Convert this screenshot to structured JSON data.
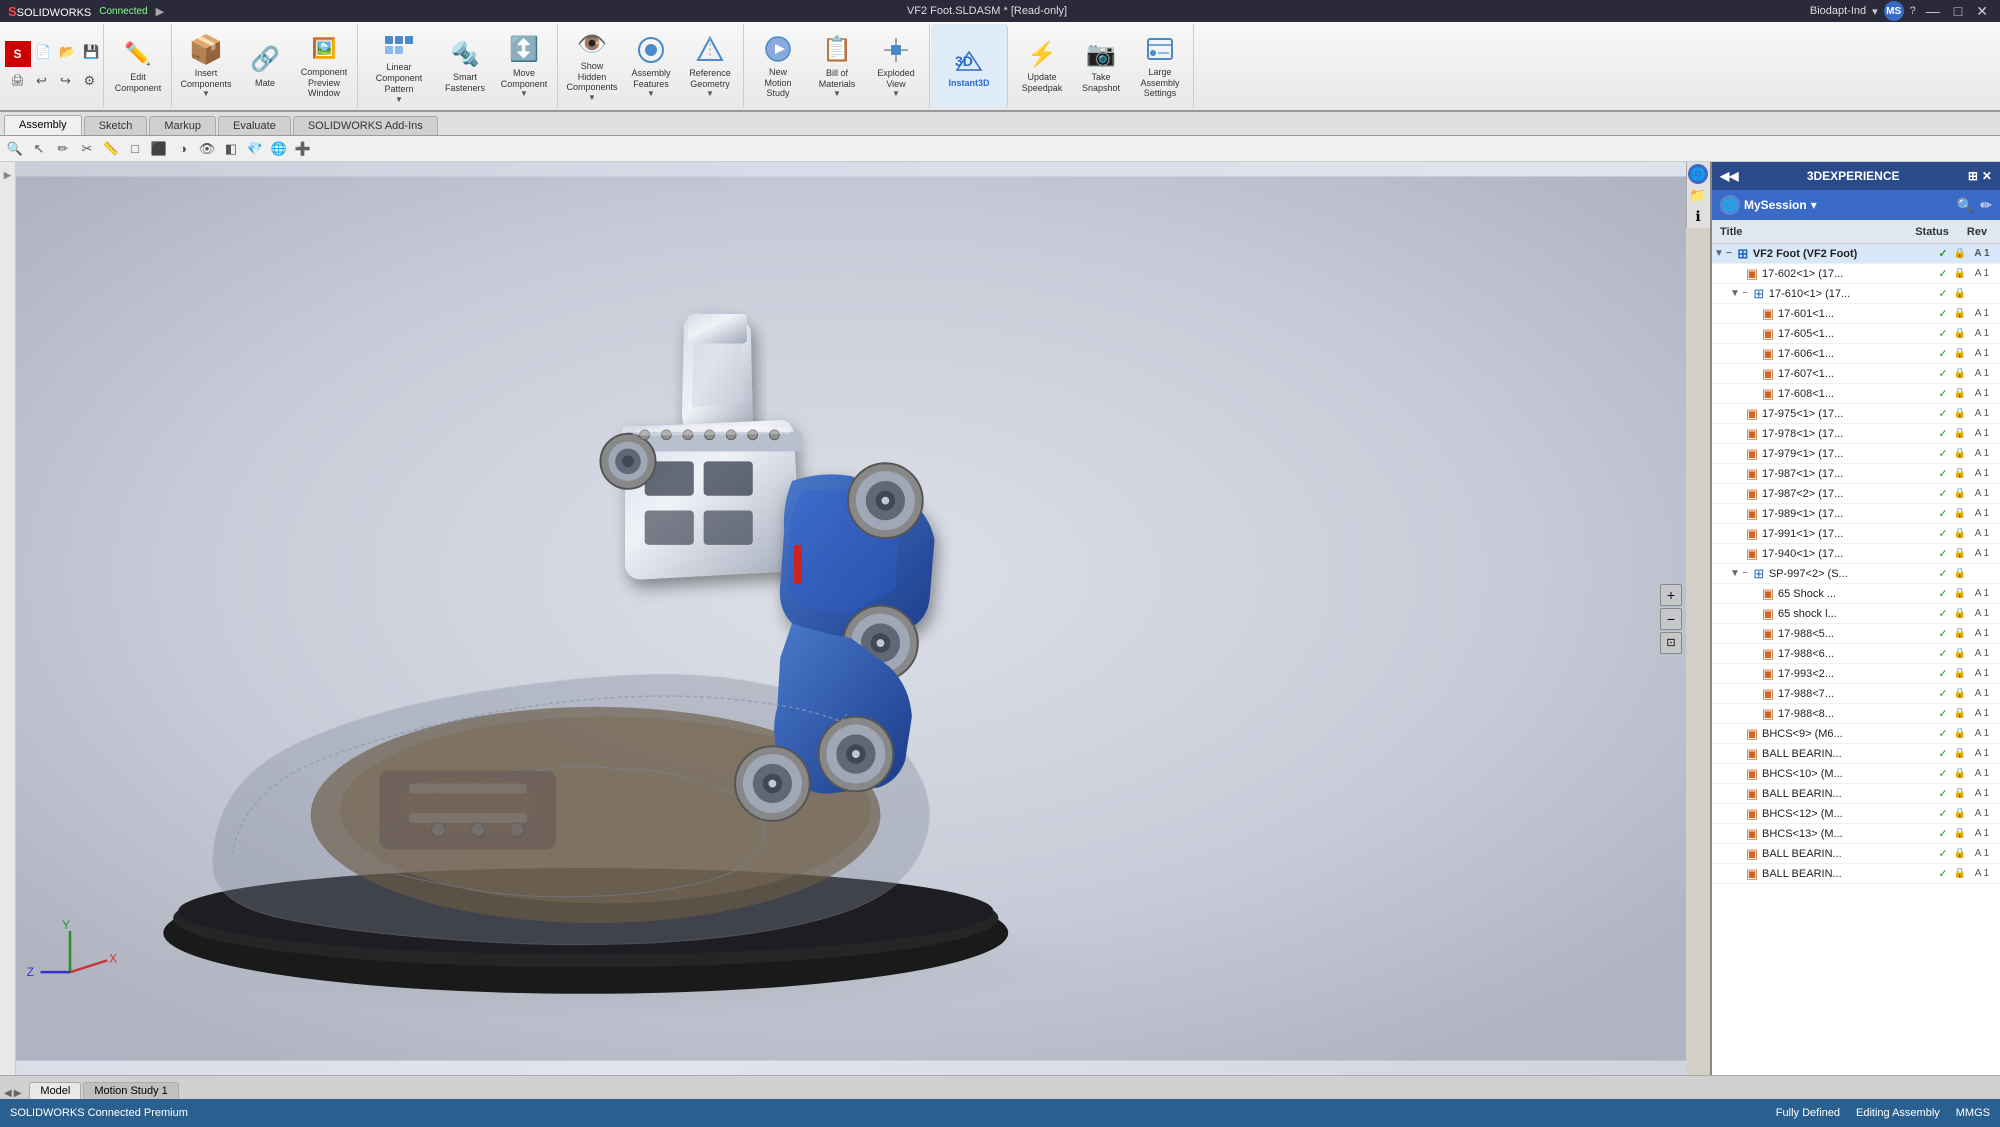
{
  "app": {
    "title": "VF2 Foot.SLDASM * [Read-only]",
    "name": "SOLIDWORKS Connected",
    "status": "Connected",
    "premium": "SOLIDWORKS Connected Premium"
  },
  "header": {
    "user": "MS",
    "company": "Biodapt-Ind"
  },
  "toolbar": {
    "groups": [
      {
        "buttons": [
          {
            "label": "Edit Component",
            "icon": "✏️"
          },
          {
            "label": "Insert Components",
            "icon": "📦"
          },
          {
            "label": "Mate",
            "icon": "🔗"
          },
          {
            "label": "Component Preview Window",
            "icon": "🖼️"
          }
        ]
      },
      {
        "buttons": [
          {
            "label": "Linear Component Pattern",
            "icon": "⊞"
          },
          {
            "label": "Smart Fasteners",
            "icon": "🔩"
          },
          {
            "label": "Move Component",
            "icon": "↕️"
          }
        ]
      },
      {
        "buttons": [
          {
            "label": "Show Hidden Components",
            "icon": "👁️"
          },
          {
            "label": "Assembly Features",
            "icon": "⚙️"
          },
          {
            "label": "Reference Geometry",
            "icon": "📐"
          }
        ]
      },
      {
        "buttons": [
          {
            "label": "New Motion Study",
            "icon": "▶️"
          },
          {
            "label": "Bill of Materials",
            "icon": "📋"
          },
          {
            "label": "Exploded View",
            "icon": "💥"
          }
        ]
      },
      {
        "buttons": [
          {
            "label": "Instant3D",
            "icon": "3D"
          }
        ]
      },
      {
        "buttons": [
          {
            "label": "Update Speedpak",
            "icon": "⚡"
          },
          {
            "label": "Take Snapshot",
            "icon": "📷"
          },
          {
            "label": "Large Assembly Settings",
            "icon": "⚙️"
          }
        ]
      }
    ]
  },
  "tabs": {
    "main": [
      "Assembly",
      "Sketch",
      "Markup",
      "Evaluate",
      "SOLIDWORKS Add-Ins"
    ],
    "active": "Assembly",
    "bottom": [
      "Model",
      "Motion Study 1"
    ],
    "bottom_active": "Model"
  },
  "tree": {
    "title": "Title",
    "status_col": "Status",
    "rev_col": "Rev",
    "panel_title": "3DEXPERIENCE",
    "session": "MySession",
    "items": [
      {
        "id": 0,
        "label": "VF2 Foot (VF2 Foot)",
        "level": 0,
        "expanded": true,
        "has_children": true,
        "type": "assembly",
        "status": "✓",
        "locked": true,
        "rev": "A 1"
      },
      {
        "id": 1,
        "label": "17-602<1> (17...",
        "level": 1,
        "expanded": false,
        "has_children": false,
        "type": "part",
        "status": "✓",
        "locked": true,
        "rev": "A 1"
      },
      {
        "id": 2,
        "label": "17-610<1> (17...",
        "level": 1,
        "expanded": true,
        "has_children": true,
        "type": "assembly",
        "status": "✓",
        "locked": true,
        "rev": ""
      },
      {
        "id": 3,
        "label": "17-601<1...",
        "level": 2,
        "expanded": false,
        "has_children": false,
        "type": "part",
        "status": "✓",
        "locked": true,
        "rev": "A 1"
      },
      {
        "id": 4,
        "label": "17-605<1...",
        "level": 2,
        "expanded": false,
        "has_children": false,
        "type": "part",
        "status": "✓",
        "locked": true,
        "rev": "A 1"
      },
      {
        "id": 5,
        "label": "17-606<1...",
        "level": 2,
        "expanded": false,
        "has_children": false,
        "type": "part",
        "status": "✓",
        "locked": true,
        "rev": "A 1"
      },
      {
        "id": 6,
        "label": "17-607<1...",
        "level": 2,
        "expanded": false,
        "has_children": false,
        "type": "part",
        "status": "✓",
        "locked": true,
        "rev": "A 1"
      },
      {
        "id": 7,
        "label": "17-608<1...",
        "level": 2,
        "expanded": false,
        "has_children": false,
        "type": "part",
        "status": "✓",
        "locked": true,
        "rev": "A 1"
      },
      {
        "id": 8,
        "label": "17-975<1> (17...",
        "level": 1,
        "expanded": false,
        "has_children": false,
        "type": "part",
        "status": "✓",
        "locked": true,
        "rev": "A 1"
      },
      {
        "id": 9,
        "label": "17-978<1> (17...",
        "level": 1,
        "expanded": false,
        "has_children": false,
        "type": "part",
        "status": "✓",
        "locked": true,
        "rev": "A 1"
      },
      {
        "id": 10,
        "label": "17-979<1> (17...",
        "level": 1,
        "expanded": false,
        "has_children": false,
        "type": "part",
        "status": "✓",
        "locked": true,
        "rev": "A 1"
      },
      {
        "id": 11,
        "label": "17-987<1> (17...",
        "level": 1,
        "expanded": false,
        "has_children": false,
        "type": "part",
        "status": "✓",
        "locked": true,
        "rev": "A 1"
      },
      {
        "id": 12,
        "label": "17-987<2> (17...",
        "level": 1,
        "expanded": false,
        "has_children": false,
        "type": "part",
        "status": "✓",
        "locked": true,
        "rev": "A 1"
      },
      {
        "id": 13,
        "label": "17-989<1> (17...",
        "level": 1,
        "expanded": false,
        "has_children": false,
        "type": "part",
        "status": "✓",
        "locked": true,
        "rev": "A 1"
      },
      {
        "id": 14,
        "label": "17-991<1> (17...",
        "level": 1,
        "expanded": false,
        "has_children": false,
        "type": "part",
        "status": "✓",
        "locked": true,
        "rev": "A 1"
      },
      {
        "id": 15,
        "label": "17-940<1> (17...",
        "level": 1,
        "expanded": false,
        "has_children": false,
        "type": "part",
        "status": "✓",
        "locked": true,
        "rev": "A 1"
      },
      {
        "id": 16,
        "label": "SP-997<2> (S...",
        "level": 1,
        "expanded": true,
        "has_children": true,
        "type": "assembly",
        "status": "✓",
        "locked": true,
        "rev": ""
      },
      {
        "id": 17,
        "label": "65 Shock ...",
        "level": 2,
        "expanded": false,
        "has_children": false,
        "type": "part",
        "status": "✓",
        "locked": true,
        "rev": "A 1"
      },
      {
        "id": 18,
        "label": "65 shock l...",
        "level": 2,
        "expanded": false,
        "has_children": false,
        "type": "part",
        "status": "✓",
        "locked": true,
        "rev": "A 1"
      },
      {
        "id": 19,
        "label": "17-988<5...",
        "level": 2,
        "expanded": false,
        "has_children": false,
        "type": "part",
        "status": "✓",
        "locked": true,
        "rev": "A 1"
      },
      {
        "id": 20,
        "label": "17-988<6...",
        "level": 2,
        "expanded": false,
        "has_children": false,
        "type": "part",
        "status": "✓",
        "locked": true,
        "rev": "A 1"
      },
      {
        "id": 21,
        "label": "17-993<2...",
        "level": 2,
        "expanded": false,
        "has_children": false,
        "type": "part",
        "status": "✓",
        "locked": true,
        "rev": "A 1"
      },
      {
        "id": 22,
        "label": "17-988<7...",
        "level": 2,
        "expanded": false,
        "has_children": false,
        "type": "part",
        "status": "✓",
        "locked": true,
        "rev": "A 1"
      },
      {
        "id": 23,
        "label": "17-988<8...",
        "level": 2,
        "expanded": false,
        "has_children": false,
        "type": "part",
        "status": "✓",
        "locked": true,
        "rev": "A 1"
      },
      {
        "id": 24,
        "label": "BHCS<9> (M6...",
        "level": 1,
        "expanded": false,
        "has_children": false,
        "type": "part",
        "status": "✓",
        "locked": true,
        "rev": "A 1"
      },
      {
        "id": 25,
        "label": "BALL BEARIN...",
        "level": 1,
        "expanded": false,
        "has_children": false,
        "type": "part",
        "status": "✓",
        "locked": true,
        "rev": "A 1"
      },
      {
        "id": 26,
        "label": "BHCS<10> (M...",
        "level": 1,
        "expanded": false,
        "has_children": false,
        "type": "part",
        "status": "✓",
        "locked": true,
        "rev": "A 1"
      },
      {
        "id": 27,
        "label": "BALL BEARIN...",
        "level": 1,
        "expanded": false,
        "has_children": false,
        "type": "part",
        "status": "✓",
        "locked": true,
        "rev": "A 1"
      },
      {
        "id": 28,
        "label": "BHCS<12> (M...",
        "level": 1,
        "expanded": false,
        "has_children": false,
        "type": "part",
        "status": "✓",
        "locked": true,
        "rev": "A 1"
      },
      {
        "id": 29,
        "label": "BHCS<13> (M...",
        "level": 1,
        "expanded": false,
        "has_children": false,
        "type": "part",
        "status": "✓",
        "locked": true,
        "rev": "A 1"
      },
      {
        "id": 30,
        "label": "BALL BEARIN...",
        "level": 1,
        "expanded": false,
        "has_children": false,
        "type": "part",
        "status": "✓",
        "locked": true,
        "rev": "A 1"
      },
      {
        "id": 31,
        "label": "BALL BEARIN...",
        "level": 1,
        "expanded": false,
        "has_children": false,
        "type": "part",
        "status": "✓",
        "locked": true,
        "rev": "A 1"
      }
    ]
  },
  "status_bar": {
    "left": "SOLIDWORKS Connected Premium",
    "center_left": "Fully Defined",
    "center_right": "Editing Assembly",
    "right": "MMGS"
  },
  "viewport": {
    "cursor_x": "",
    "cursor_y": ""
  }
}
